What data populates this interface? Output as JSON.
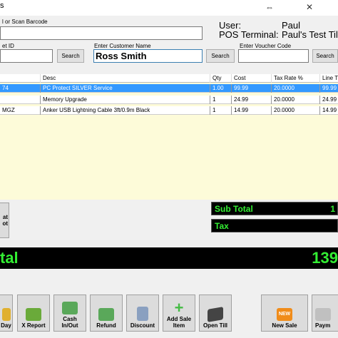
{
  "window": {
    "title_fragment": "s",
    "minimize_glyph": "—",
    "restore_glyph": "⇔",
    "close_glyph": "✕"
  },
  "scan": {
    "label": "l or Scan Barcode",
    "value": ""
  },
  "session": {
    "user_label": "User:",
    "user_value": "Paul",
    "terminal_label": "POS Terminal:",
    "terminal_value": "Paul's Test Till"
  },
  "search_row": {
    "basket_label": "et ID",
    "basket_value": "",
    "search1_label": "Search",
    "customer_label": "Enter Customer Name",
    "customer_value": "Ross Smith",
    "search2_label": "Search",
    "voucher_label": "Enter Voucher Code",
    "voucher_value": "",
    "search3_label": "Search"
  },
  "grid": {
    "columns": [
      "",
      "Desc",
      "Qty",
      "Cost",
      "Tax Rate %",
      "Line T"
    ],
    "rows": [
      {
        "code": "74",
        "desc": "PC Protect SILVER Service",
        "qty": "1.00",
        "cost": "99.99",
        "tax": "20.0000",
        "line": "99.99",
        "selected": true
      },
      {
        "code": "",
        "desc": "Memory Upgrade",
        "qty": "1",
        "cost": "24.99",
        "tax": "20.0000",
        "line": "24.99",
        "selected": false
      },
      {
        "code": "MGZ",
        "desc": "Anker USB Lightning Cable 3ft/0.9m Black",
        "qty": "1",
        "cost": "14.99",
        "tax": "20.0000",
        "line": "14.99",
        "selected": false
      }
    ]
  },
  "side_button": {
    "line1": "at",
    "line2": "ot"
  },
  "totals": {
    "subtotal_label": "Sub Total",
    "subtotal_value": "1",
    "tax_label": "Tax",
    "tax_value": "",
    "total_label": "tal",
    "total_value": "139"
  },
  "toolbar": [
    {
      "label": "Day",
      "icon": "calendar-icon",
      "color": "#e0b030"
    },
    {
      "label": "X Report",
      "icon": "report-icon",
      "color": "#6aaa3a"
    },
    {
      "label": "Cash In/Out",
      "icon": "cash-icon",
      "color": "#5aa85a"
    },
    {
      "label": "Refund",
      "icon": "refund-icon",
      "color": "#5aa85a"
    },
    {
      "label": "Discount",
      "icon": "calculator-icon",
      "color": "#8aa0c0"
    },
    {
      "label": "Add Sale Item",
      "icon": "plus-icon",
      "color": "#44bb44"
    },
    {
      "label": "Open Till",
      "icon": "till-icon",
      "color": "#444444"
    },
    {
      "label": "New Sale",
      "icon": "new-badge-icon",
      "color": "#f08c1a",
      "badge": "NEW"
    },
    {
      "label": "Paym",
      "icon": "payment-icon",
      "color": "#c0c0c0"
    }
  ]
}
